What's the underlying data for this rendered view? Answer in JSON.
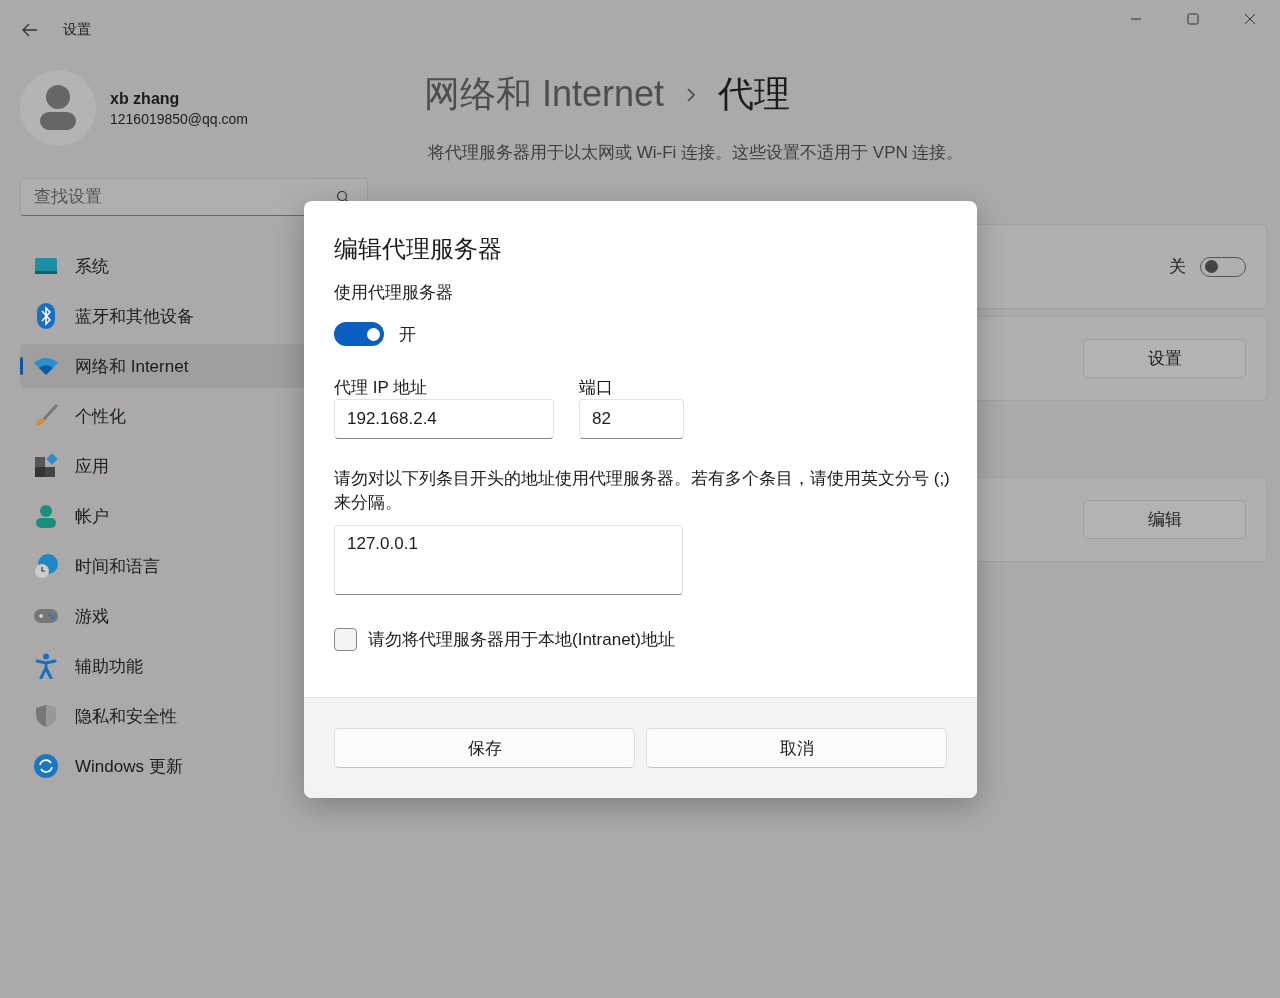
{
  "window": {
    "title": "设置"
  },
  "user": {
    "name": "xb zhang",
    "email": "1216019850@qq.com"
  },
  "search": {
    "placeholder": "查找设置"
  },
  "sidebar": {
    "items": [
      {
        "label": "系统",
        "selected": false
      },
      {
        "label": "蓝牙和其他设备",
        "selected": false
      },
      {
        "label": "网络和 Internet",
        "selected": true
      },
      {
        "label": "个性化",
        "selected": false
      },
      {
        "label": "应用",
        "selected": false
      },
      {
        "label": "帐户",
        "selected": false
      },
      {
        "label": "时间和语言",
        "selected": false
      },
      {
        "label": "游戏",
        "selected": false
      },
      {
        "label": "辅助功能",
        "selected": false
      },
      {
        "label": "隐私和安全性",
        "selected": false
      },
      {
        "label": "Windows 更新",
        "selected": false
      }
    ]
  },
  "header": {
    "parent": "网络和 Internet",
    "current": "代理",
    "description": "将代理服务器用于以太网或 Wi-Fi 连接。这些设置不适用于 VPN 连接。"
  },
  "cards": [
    {
      "kind": "toggle",
      "state_label": "关",
      "on": false
    },
    {
      "kind": "button",
      "button": "设置"
    },
    {
      "kind": "button",
      "button": "编辑"
    }
  ],
  "dialog": {
    "title": "编辑代理服务器",
    "toggle_label": "使用代理服务器",
    "toggle_on": true,
    "toggle_text": "开",
    "ip_label": "代理 IP 地址",
    "ip": "192.168.2.4",
    "port_label": "端口",
    "port": "82",
    "exceptions_label": "请勿对以下列条目开头的地址使用代理服务器。若有多个条目，请使用英文分号 (;) 来分隔。",
    "exceptions": "127.0.0.1",
    "local_checkbox": {
      "label": "请勿将代理服务器用于本地(Intranet)地址",
      "checked": false
    },
    "buttons": [
      "保存",
      "取消"
    ]
  }
}
